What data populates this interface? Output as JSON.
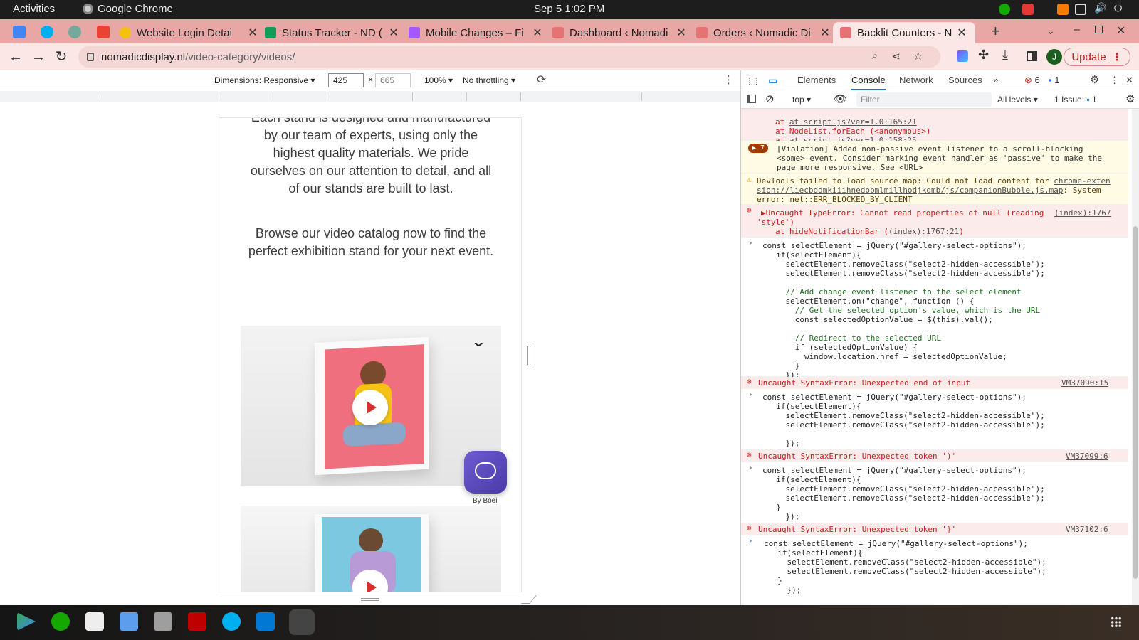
{
  "topbar": {
    "activities": "Activities",
    "app": "Google Chrome",
    "clock": "Sep 5  1:02 PM"
  },
  "tabs": [
    {
      "title": "Website Login Detai",
      "icon": "yellow-face-icon",
      "color": "#f4c20d"
    },
    {
      "title": "Status Tracker - ND (",
      "icon": "sheets-icon",
      "color": "#0f9d58"
    },
    {
      "title": "Mobile Changes – Fi",
      "icon": "figma-icon",
      "color": "#a259ff"
    },
    {
      "title": "Dashboard ‹ Nomadi",
      "icon": "site-favicon-icon",
      "color": "#e57373"
    },
    {
      "title": "Orders ‹ Nomadic Di",
      "icon": "site-favicon-icon",
      "color": "#e57373"
    },
    {
      "title": "Backlit Counters - N",
      "icon": "site-favicon-icon",
      "color": "#e57373"
    }
  ],
  "toolbar": {
    "url_domain": "nomadicdisplay.nl",
    "url_path": "/video-category/videos/",
    "update": "Update",
    "avatar": "J"
  },
  "device": {
    "dimensions": "Dimensions: Responsive",
    "width": "425",
    "x": "×",
    "height": "665",
    "zoom": "100%",
    "throttle": "No throttling"
  },
  "page": {
    "para1": [
      "Each stand is designed and manufactured",
      "by our team of experts, using only the",
      "highest quality materials. We pride",
      "ourselves on our attention to detail, and all",
      "of our stands are built to last."
    ],
    "para2": [
      "Browse our video catalog now to find the",
      "perfect exhibition stand for your next event."
    ],
    "chat_by": "By Boei"
  },
  "devtools": {
    "tabs": [
      "Elements",
      "Console",
      "Network",
      "Sources"
    ],
    "err_count": "6",
    "msg_count": "1",
    "context": "top",
    "filter_placeholder": "Filter",
    "levels": "All levels",
    "issues_label": "1 Issue:",
    "issues_count": "1",
    "violation_count": "7",
    "lines": {
      "s0": "at script.js?ver=1.0:165:21",
      "s1": "at NodeList.forEach (<anonymous>)",
      "s2": "at script.js?ver=1.0:158:25",
      "v1": "[Violation] Added non-passive event listener to a scroll-blocking",
      "v2": "<some> event. Consider marking event handler as 'passive' to make the",
      "v3": "page more responsive. See <URL>",
      "w1": "DevTools failed to load source map: Could not load content for ",
      "w1link": "chrome-exten",
      "w2link": "sion://liecbddmkiiihnedobmlmillhodjkdmb/js/companionBubble.js.map",
      "w2": ": System",
      "w3": "error: net::ERR_BLOCKED_BY_CLIENT",
      "e1": "Uncaught TypeError: Cannot read properties of null (reading",
      "e1link": "(index):1767",
      "e2": "'style')",
      "e3": "at hideNotificationBar (",
      "e3link": "(index):1767:21",
      "e3end": ")",
      "c1": "const selectElement = jQuery(\"#gallery-select-options\");",
      "c2": "  if(selectElement){",
      "c3": "    selectElement.removeClass(\"select2-hidden-accessible\");",
      "c4": "    selectElement.removeClass(\"select2-hidden-accessible\");",
      "c5": "    // Add change event listener to the select element",
      "c6": "    selectElement.on(\"change\", function () {",
      "c7": "      // Get the selected option's value, which is the URL",
      "c8": "      const selectedOptionValue = $(this).val();",
      "c9": "      // Redirect to the selected URL",
      "c10": "      if (selectedOptionValue) {",
      "c11": "        window.location.href = selectedOptionValue;",
      "c12": "      }",
      "c13": "    });",
      "x1": "Uncaught SyntaxError: Unexpected end of input",
      "x1link": "VM37090:15",
      "x2": "Uncaught SyntaxError: Unexpected token ')'",
      "x2link": "VM37099:6",
      "x3": "Uncaught SyntaxError: Unexpected token '}'",
      "x3link": "VM37102:6",
      "close1": "  }",
      "close2": "    });"
    }
  }
}
